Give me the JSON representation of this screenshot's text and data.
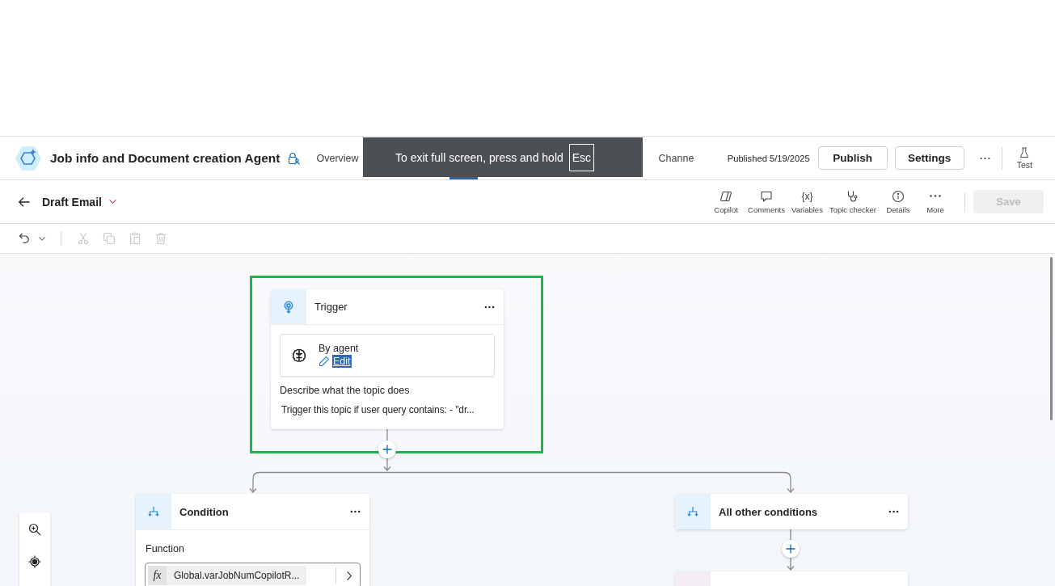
{
  "header": {
    "agent_name": "Job info and Document creation Agent",
    "tabs": [
      {
        "label": "Overview",
        "selected": false
      },
      {
        "selected": true
      },
      {
        "label": "Channe",
        "selected": false
      }
    ],
    "published": "Published 5/19/2025",
    "buttons": [
      "Publish",
      "Settings"
    ],
    "test": "Test"
  },
  "fullscreen_notice": {
    "text": "To exit full screen, press and hold",
    "key": "Esc"
  },
  "topic_bar": {
    "title": "Draft Email",
    "tools": [
      {
        "kind": "copilot",
        "label": "Copilot"
      },
      {
        "kind": "comments",
        "label": "Comments"
      },
      {
        "kind": "variables",
        "glyph": "{x}",
        "label": "Variables"
      },
      {
        "kind": "topic_checker",
        "label": "Topic checker"
      },
      {
        "kind": "details",
        "label": "Details"
      },
      {
        "kind": "more",
        "label": "More"
      }
    ],
    "save": {
      "label": "Save",
      "disabled": true
    }
  },
  "edit_toolbar": [
    {
      "kind": "undo",
      "disabled": false
    },
    {
      "kind": "cut",
      "disabled": true
    },
    {
      "kind": "copy",
      "disabled": true
    },
    {
      "kind": "paste",
      "disabled": true
    },
    {
      "kind": "delete",
      "disabled": true
    }
  ],
  "canvas": {
    "trigger": {
      "title": "Trigger",
      "source": "By agent",
      "edit_link": {
        "label": "Edit",
        "selected": true
      },
      "description_label": "Describe what the topic does",
      "description": "Trigger this topic if user query contains: - \"dr..."
    },
    "branches": [
      {
        "kind": "condition",
        "title": "Condition",
        "field_label": "Function",
        "formula_prefix": "fx",
        "formula": "Global.varJobNumCopilotR..."
      },
      {
        "kind": "else",
        "title": "All other conditions"
      }
    ],
    "next_node": {
      "kind": "message"
    }
  }
}
